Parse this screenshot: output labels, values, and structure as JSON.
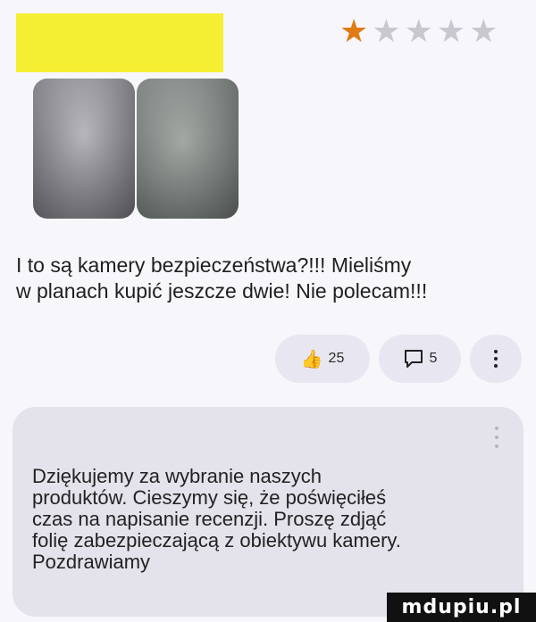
{
  "review": {
    "rating": 1,
    "max_rating": 5,
    "star_color_on": "#e07a12",
    "star_color_off": "#c9c8d0",
    "text_lines": [
      "I to są kamery bezpieczeństwa?!!! Mieliśmy",
      "w planach kupić jeszcze dwie! Nie polecam!!!"
    ]
  },
  "actions": {
    "likes": "25",
    "comments": "5"
  },
  "reply": {
    "text_lines": [
      "Dziękujemy za wybranie naszych",
      "produktów. Cieszymy się, że poświęciłeś",
      "czas na napisanie recenzji. Proszę zdjąć",
      "folię zabezpieczającą z obiektywu kamery.",
      "Pozdrawiamy"
    ]
  },
  "watermark": "mdupiu.pl"
}
